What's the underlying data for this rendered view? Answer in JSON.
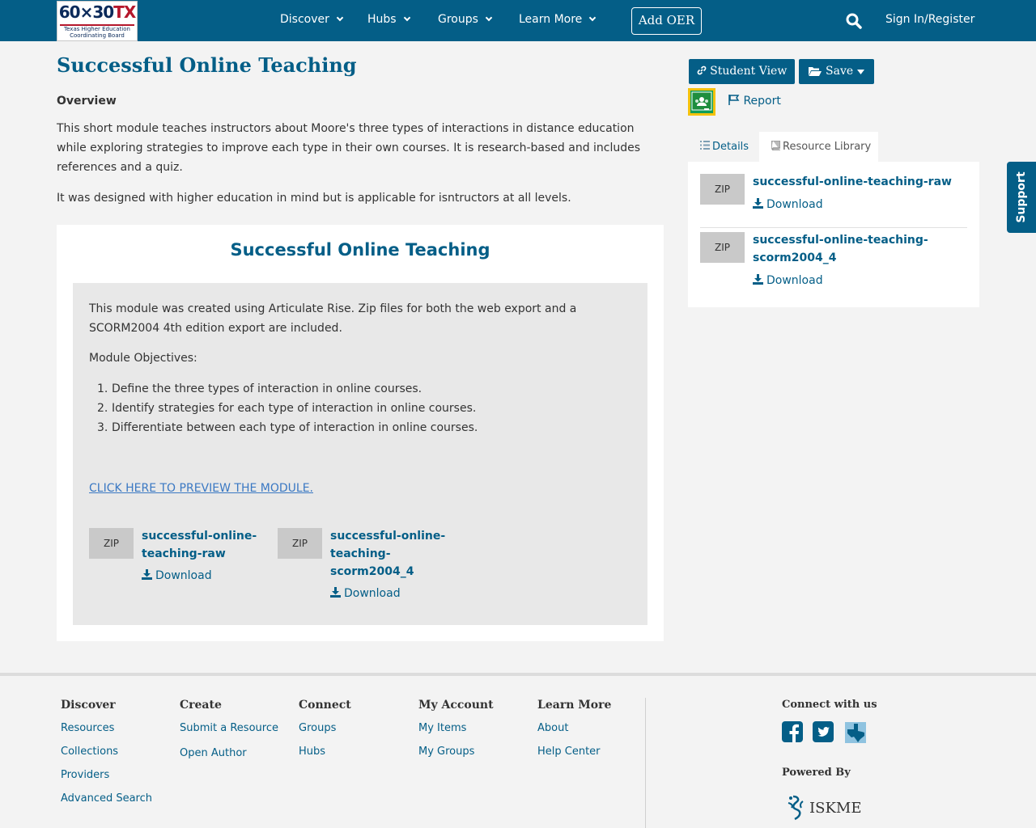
{
  "header": {
    "logo_main": "60×30",
    "logo_tx": "TX",
    "logo_sub1": "Texas Higher Education",
    "logo_sub2": "Coordinating Board",
    "nav": [
      "Discover",
      "Hubs",
      "Groups",
      "Learn More"
    ],
    "add_oer": "Add OER",
    "sign_in": "Sign In/Register"
  },
  "main": {
    "title": "Successful Online Teaching",
    "overview_heading": "Overview",
    "overview_p1": "This short module teaches instructors about Moore's three types of interactions in distance education while exploring strategies to improve each type in their own courses. It is research-based and includes references and a quiz.",
    "overview_p2": "It was designed with higher education in mind but is applicable for isntructors at all levels.",
    "card_title": "Successful Online Teaching",
    "module_intro": "This module was created using Articulate Rise. Zip files for both the web export and a SCORM2004 4th edition export are included.",
    "objectives_label": "Module Objectives:",
    "objectives": [
      "Define the three types of interaction in online courses.",
      "Identify strategies for each type of interaction in online courses.",
      "Differentiate between each type of interaction in online courses."
    ],
    "preview_link": "CLICK HERE TO PREVIEW THE MODULE.",
    "files": [
      {
        "type": "ZIP",
        "name_line1": "successful-online-",
        "name_line2": "teaching-raw",
        "name_line3": "",
        "download": "Download"
      },
      {
        "type": "ZIP",
        "name_line1": "successful-online-",
        "name_line2": "teaching-",
        "name_line3": "scorm2004_4",
        "download": "Download"
      }
    ]
  },
  "sidebar": {
    "student_view": "Student View",
    "save": "Save",
    "report": "Report",
    "tabs": [
      "Details",
      "Resource Library"
    ],
    "library": [
      {
        "type": "ZIP",
        "name_line1": "successful-online-teaching-raw",
        "name_line2": "",
        "download": "Download"
      },
      {
        "type": "ZIP",
        "name_line1": "successful-online-teaching-",
        "name_line2": "scorm2004_4",
        "download": "Download"
      }
    ]
  },
  "support": "Support",
  "footer": {
    "discover": {
      "heading": "Discover",
      "links": [
        "Resources",
        "Collections",
        "Providers",
        "Advanced Search"
      ]
    },
    "create": {
      "heading": "Create",
      "links": [
        "Submit a Resource",
        "Open Author"
      ]
    },
    "connect": {
      "heading": "Connect",
      "links": [
        "Groups",
        "Hubs"
      ]
    },
    "my_account": {
      "heading": "My Account",
      "links": [
        "My Items",
        "My Groups"
      ]
    },
    "learn_more": {
      "heading": "Learn More",
      "links": [
        "About",
        "Help Center"
      ]
    },
    "connect_with_us": "Connect with us",
    "powered_by": "Powered By",
    "iskme": "ISKME"
  },
  "colors": {
    "brand": "#045e87",
    "link": "#3a78c3",
    "background": "#f3f3f3"
  }
}
